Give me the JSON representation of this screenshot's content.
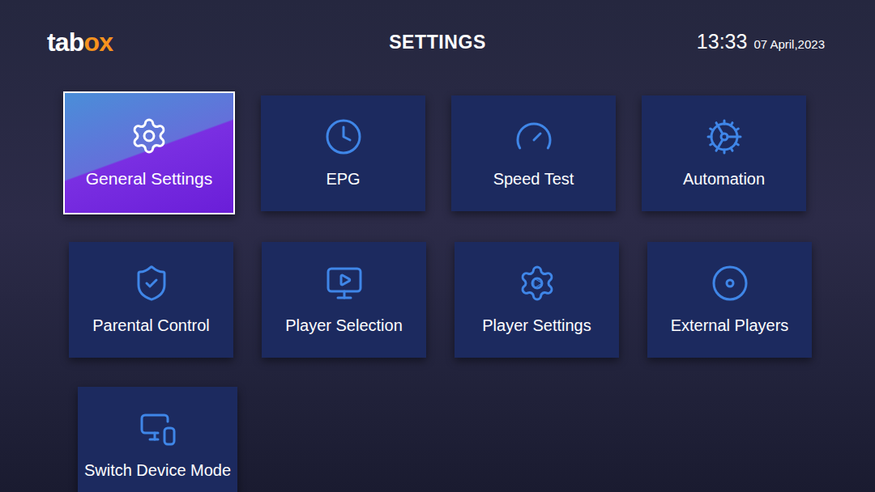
{
  "header": {
    "logo": [
      {
        "text": "tab",
        "color": "#ffffff"
      },
      {
        "text": "ox",
        "color": "#f7931e"
      }
    ],
    "title": "SETTINGS",
    "time": "13:33",
    "date": "07 April,2023"
  },
  "tiles": [
    {
      "label": "General Settings",
      "selected": true
    },
    {
      "label": "EPG",
      "selected": false
    },
    {
      "label": "Speed Test",
      "selected": false
    },
    {
      "label": "Automation",
      "selected": false
    },
    {
      "label": "Parental Control",
      "selected": false
    },
    {
      "label": "Player Selection",
      "selected": false
    },
    {
      "label": "Player Settings",
      "selected": false
    },
    {
      "label": "External Players",
      "selected": false
    },
    {
      "label": "Switch Device Mode",
      "selected": false
    }
  ]
}
